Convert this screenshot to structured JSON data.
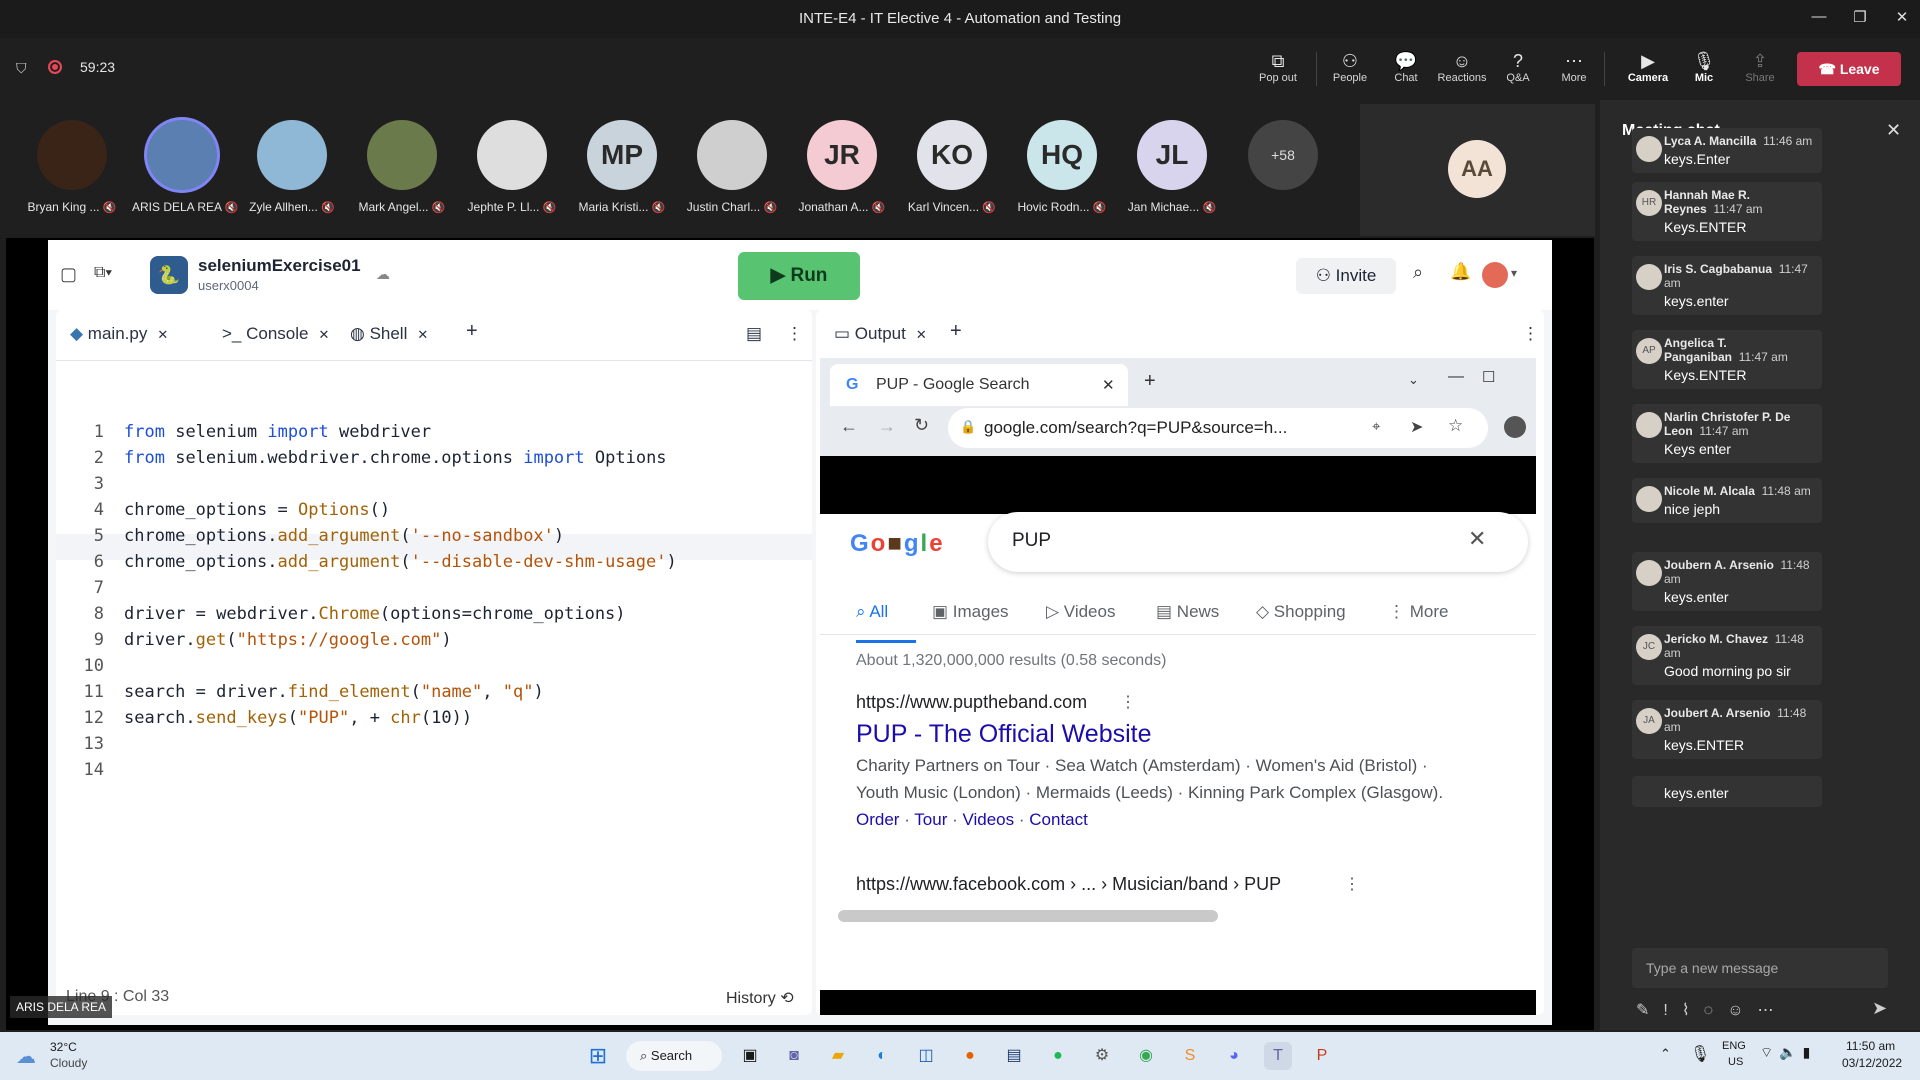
{
  "window": {
    "title": "INTE-E4 - IT Elective 4 - Automation and Testing"
  },
  "meeting": {
    "timer": "59:23"
  },
  "toolbar": [
    {
      "label": "Pop out",
      "icon": "popout-icon"
    },
    {
      "label": "People",
      "icon": "people-icon"
    },
    {
      "label": "Chat",
      "icon": "chat-icon"
    },
    {
      "label": "Reactions",
      "icon": "reactions-icon"
    },
    {
      "label": "Q&A",
      "icon": "qa-icon"
    },
    {
      "label": "More",
      "icon": "more-icon"
    },
    {
      "label": "Camera",
      "icon": "camera-icon"
    },
    {
      "label": "Mic",
      "icon": "mic-icon"
    },
    {
      "label": "Share",
      "icon": "share-icon"
    }
  ],
  "leave_label": "Leave",
  "participants": [
    {
      "name": "Bryan King ...",
      "initials": "",
      "color": "#3a2418"
    },
    {
      "name": "ARIS DELA REA",
      "initials": "",
      "color": "#5b7fb0"
    },
    {
      "name": "Zyle Allhen...",
      "initials": "",
      "color": "#8fb7d6"
    },
    {
      "name": "Mark Angel...",
      "initials": "",
      "color": "#6b7a4a"
    },
    {
      "name": "Jephte P. Ll...",
      "initials": "",
      "color": "#dedede"
    },
    {
      "name": "Maria Kristi...",
      "initials": "MP",
      "color": "#c9d3dc"
    },
    {
      "name": "Justin Charl...",
      "initials": "",
      "color": "#cfcfcf"
    },
    {
      "name": "Jonathan A...",
      "initials": "JR",
      "color": "#f5cbd3"
    },
    {
      "name": "Karl Vincen...",
      "initials": "KO",
      "color": "#e2e2ea"
    },
    {
      "name": "Hovic Rodn...",
      "initials": "HQ",
      "color": "#cbe6ea"
    },
    {
      "name": "Jan Michae...",
      "initials": "JL",
      "color": "#d9d4ee"
    }
  ],
  "more_participants": "+58",
  "self_tile": {
    "initials": "AA"
  },
  "replit": {
    "project": "seleniumExercise01",
    "user": "userx0004",
    "run_label": "Run",
    "invite_label": "Invite",
    "tabs": [
      "main.py",
      "Console",
      "Shell"
    ],
    "output_tab": "Output",
    "code": [
      {
        "n": "1",
        "t": [
          [
            "kw",
            "from"
          ],
          [
            "",
            "selenium"
          ],
          [
            "kw",
            "import"
          ],
          [
            "",
            "webdriver"
          ]
        ]
      },
      {
        "n": "2",
        "t": [
          [
            "kw",
            "from"
          ],
          [
            "",
            "selenium.webdriver.chrome.options"
          ],
          [
            "kw",
            "import"
          ],
          [
            "",
            "Options"
          ]
        ]
      },
      {
        "n": "3",
        "t": []
      },
      {
        "n": "4",
        "t": [
          [
            "",
            "chrome_options = "
          ],
          [
            "fn",
            "Options"
          ],
          [
            "",
            "()"
          ]
        ]
      },
      {
        "n": "5",
        "t": [
          [
            "",
            "chrome_options."
          ],
          [
            "fn",
            "add_argument"
          ],
          [
            "",
            "("
          ],
          [
            "st",
            "'--no-sandbox'"
          ],
          [
            "",
            ")"
          ]
        ]
      },
      {
        "n": "6",
        "t": [
          [
            "",
            "chrome_options."
          ],
          [
            "fn",
            "add_argument"
          ],
          [
            "",
            "("
          ],
          [
            "st",
            "'--disable-dev-shm-usage'"
          ],
          [
            "",
            ")"
          ]
        ]
      },
      {
        "n": "7",
        "t": []
      },
      {
        "n": "8",
        "t": [
          [
            "",
            "driver = webdriver."
          ],
          [
            "fn",
            "Chrome"
          ],
          [
            "",
            "(options=chrome_options)"
          ]
        ]
      },
      {
        "n": "9",
        "t": [
          [
            "",
            "driver."
          ],
          [
            "fn",
            "get"
          ],
          [
            "",
            "("
          ],
          [
            "st",
            "\"https://google.com\""
          ],
          [
            "",
            ")"
          ]
        ]
      },
      {
        "n": "10",
        "t": []
      },
      {
        "n": "11",
        "t": [
          [
            "",
            "search = driver."
          ],
          [
            "fn",
            "find_element"
          ],
          [
            "",
            "("
          ],
          [
            "st",
            "\"name\""
          ],
          [
            "",
            ", "
          ],
          [
            "st",
            "\"q\""
          ],
          [
            "",
            ")"
          ]
        ]
      },
      {
        "n": "12",
        "t": [
          [
            "",
            "search."
          ],
          [
            "fn",
            "send_keys"
          ],
          [
            "",
            "("
          ],
          [
            "st",
            "\"PUP\""
          ],
          [
            "",
            ", + "
          ],
          [
            "fn",
            "chr"
          ],
          [
            "",
            "(10))"
          ]
        ]
      },
      {
        "n": "13",
        "t": []
      },
      {
        "n": "14",
        "t": []
      }
    ],
    "status": "Line 9 : Col 33",
    "history_label": "History"
  },
  "browser": {
    "tab_title": "PUP - Google Search",
    "url": "google.com/search?q=PUP&source=h...",
    "query": "PUP",
    "nav": [
      "All",
      "Images",
      "Videos",
      "News",
      "Shopping",
      "More"
    ],
    "stats": "About 1,320,000,000 results (0.58 seconds)",
    "r1_url": "https://www.puptheband.com",
    "r1_title": "PUP - The Official Website",
    "r1_desc1": "Charity Partners on Tour · Sea Watch (Amsterdam) · Women's Aid (Bristol) ·",
    "r1_desc2": "Youth Music (London) · Mermaids (Leeds) · Kinning Park Complex (Glasgow).",
    "r1_links": [
      "Order",
      "Tour",
      "Videos",
      "Contact"
    ],
    "r2_url": "https://www.facebook.com › ... › Musician/band › PUP"
  },
  "presenter_label": "ARIS DELA REA",
  "chat": {
    "title": "Meeting chat",
    "messages": [
      {
        "name": "Lyca A. Mancilla",
        "time": "11:46 am",
        "text": "keys.Enter",
        "pic": ""
      },
      {
        "name": "Hannah Mae R. Reynes",
        "time": "11:47 am",
        "text": "Keys.ENTER",
        "pic": "HR"
      },
      {
        "name": "Iris S. Cagbabanua",
        "time": "11:47 am",
        "text": "keys.enter",
        "pic": ""
      },
      {
        "name": "Angelica T. Panganiban",
        "time": "11:47 am",
        "text": "Keys.ENTER",
        "pic": "AP"
      },
      {
        "name": "Narlin Christofer P. De Leon",
        "time": "11:47 am",
        "text": "Keys enter",
        "pic": ""
      },
      {
        "name": "Nicole M. Alcala",
        "time": "11:48 am",
        "text": "nice jeph",
        "pic": ""
      },
      {
        "name": "Joubern A. Arsenio",
        "time": "11:48 am",
        "text": "keys.enter",
        "pic": ""
      },
      {
        "name": "Jericko M. Chavez",
        "time": "11:48 am",
        "text": "Good morning po sir",
        "pic": "JC"
      },
      {
        "name": "Joubert A. Arsenio",
        "time": "11:48 am",
        "text": "keys.ENTER",
        "pic": "JA"
      },
      {
        "name": "",
        "time": "",
        "text": "keys.enter",
        "pic": ""
      }
    ],
    "input_placeholder": "Type a new message"
  },
  "taskbar": {
    "temp": "32°C",
    "weather": "Cloudy",
    "search_label": "Search",
    "lang1": "ENG",
    "lang2": "US",
    "time": "11:50 am",
    "date": "03/12/2022"
  }
}
